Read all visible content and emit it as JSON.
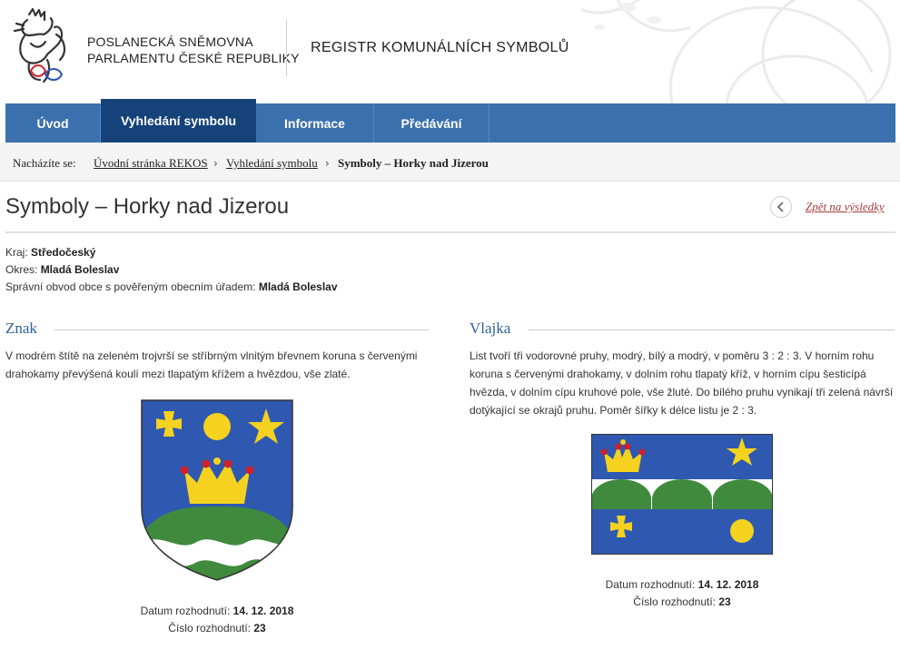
{
  "header": {
    "org_line1": "POSLANECKÁ SNĚMOVNA",
    "org_line2": "PARLAMENTU ČESKÉ REPUBLIKY",
    "registry_title": "REGISTR KOMUNÁLNÍCH SYMBOLŮ"
  },
  "nav": {
    "items": [
      {
        "label": "Úvod",
        "active": false
      },
      {
        "label": "Vyhledání symbolu",
        "active": true
      },
      {
        "label": "Informace",
        "active": false
      },
      {
        "label": "Předávání",
        "active": false
      }
    ]
  },
  "breadcrumb": {
    "prefix": "Nacházíte se:",
    "items": [
      "Úvodní stránka REKOS",
      "Vyhledání symbolu"
    ],
    "current": "Symboly – Horky nad Jizerou"
  },
  "page": {
    "title": "Symboly – Horky nad Jizerou",
    "back_label": "Zpět na výsledky"
  },
  "meta": {
    "kraj_label": "Kraj:",
    "kraj_value": "Středočeský",
    "okres_label": "Okres:",
    "okres_value": "Mladá Boleslav",
    "obvod_label": "Správní obvod obce s pověřeným obecním úřadem:",
    "obvod_value": "Mladá Boleslav"
  },
  "znak": {
    "heading": "Znak",
    "description": "V modrém štítě na zeleném trojvrší se stříbrným vlnitým břevnem koruna s červenými drahokamy převýšená koulí mezi tlapatým křížem a hvězdou, vše zlaté.",
    "date_label": "Datum rozhodnutí:",
    "date_value": "14. 12. 2018",
    "number_label": "Číslo rozhodnutí:",
    "number_value": "23"
  },
  "vlajka": {
    "heading": "Vlajka",
    "description": "List tvoří tři vodorovné pruhy, modrý, bílý a modrý, v poměru 3 : 2 : 3. V horním rohu koruna s červenými drahokamy, v dolním rohu tlapatý kříž, v horním cípu šesticípá hvězda, v dolním cípu kruhové pole, vše žluté. Do bílého pruhu vynikají tři zelená návrší dotýkající se okrajů pruhu. Poměr šířky k délce listu je 2 : 3.",
    "date_label": "Datum rozhodnutí:",
    "date_value": "14. 12. 2018",
    "number_label": "Číslo rozhodnutí:",
    "number_value": "23"
  },
  "colors": {
    "nav_bg": "#3b70ae",
    "nav_active": "#16427a",
    "heraldic_blue": "#2f58b0",
    "heraldic_gold": "#f4d21f",
    "heraldic_green": "#3f8a3c",
    "heraldic_red": "#d0202a",
    "section_heading": "#2f5f9e",
    "back_link": "#a33b3b"
  }
}
